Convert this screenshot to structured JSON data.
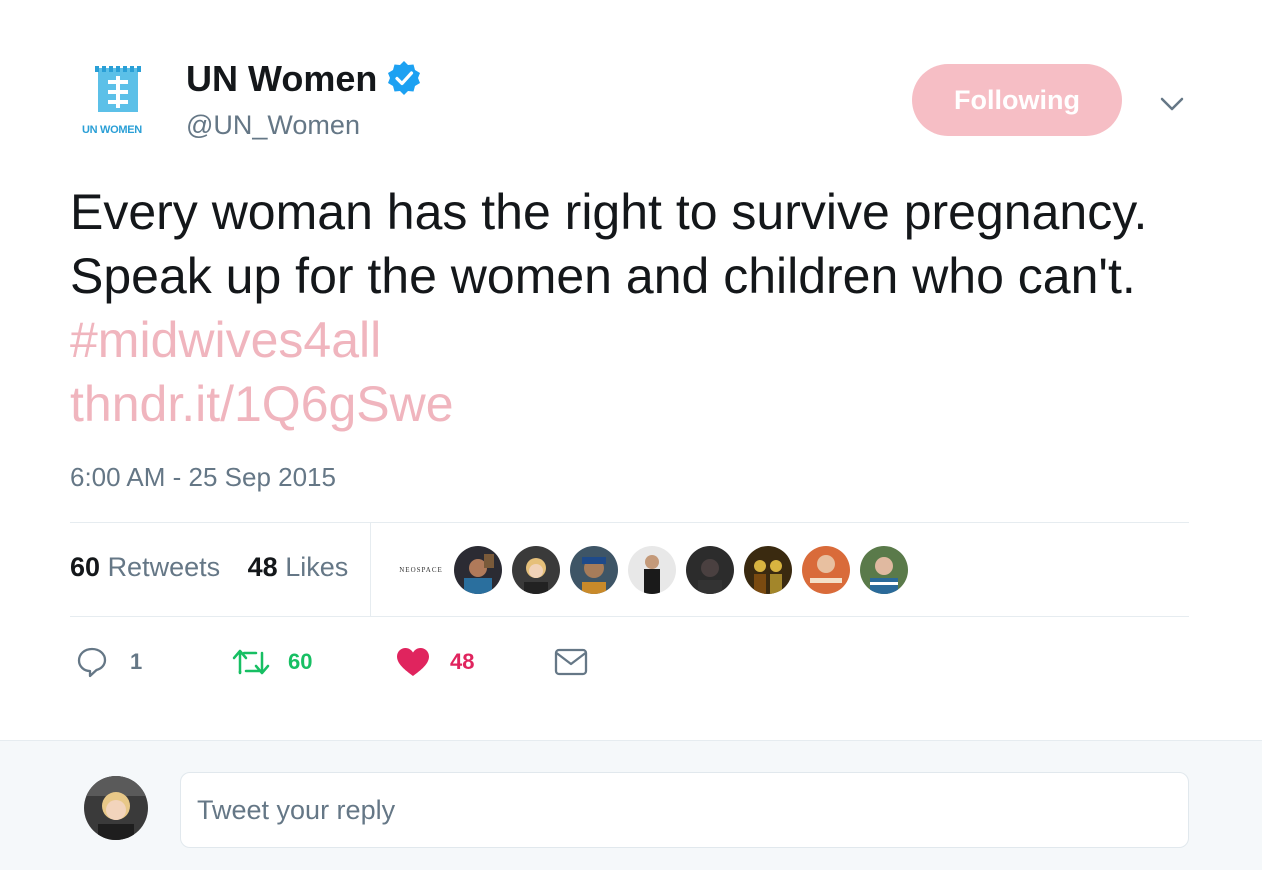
{
  "author": {
    "display_name": "UN Women",
    "handle": "@UN_Women",
    "logo_text": "UN WOMEN",
    "verified": true,
    "verified_icon": "verified-badge-icon",
    "brand_color": "#2a9fd6"
  },
  "follow_button": {
    "label": "Following",
    "color": "#f6bec5"
  },
  "menu": {
    "icon": "chevron-down-icon"
  },
  "tweet": {
    "text_plain": "Every woman has the right to survive pregnancy. Speak up for the women and children who can't. ",
    "hashtag": "#midwives4all",
    "link": "thndr.it/1Q6gSwe",
    "accent_color": "#f0b5be",
    "timestamp": "6:00 AM - 25 Sep 2015"
  },
  "stats": {
    "retweets_count": "60",
    "retweets_label": "Retweets",
    "likes_count": "48",
    "likes_label": "Likes",
    "likers_label": "NEOSPACE"
  },
  "actions": {
    "reply": {
      "icon": "reply-icon",
      "count": "1"
    },
    "retweet": {
      "icon": "retweet-icon",
      "count": "60",
      "color": "#17bf63"
    },
    "like": {
      "icon": "heart-icon",
      "count": "48",
      "color": "#e0245e"
    },
    "message": {
      "icon": "envelope-icon"
    }
  },
  "reply_box": {
    "placeholder": "Tweet your reply"
  }
}
